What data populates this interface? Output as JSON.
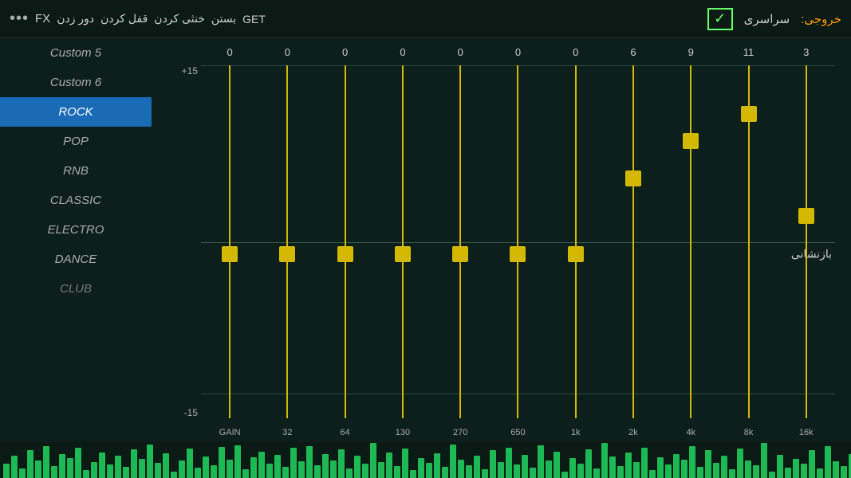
{
  "topbar": {
    "dots": "•••",
    "fx": "FX",
    "nav_items": [
      "دور زدن",
      "قفل کردن",
      "خنثی کردن",
      "بستن",
      "GET"
    ],
    "breadcrumb_label": "سراسری",
    "exit_label": "خروجی:",
    "check": "✓"
  },
  "sidebar": {
    "items": [
      {
        "label": "Custom 5",
        "active": false
      },
      {
        "label": "Custom 6",
        "active": false
      },
      {
        "label": "ROCK",
        "active": true
      },
      {
        "label": "POP",
        "active": false
      },
      {
        "label": "RNB",
        "active": false
      },
      {
        "label": "CLASSIC",
        "active": false
      },
      {
        "label": "ELECTRO",
        "active": false
      },
      {
        "label": "DANCE",
        "active": false
      },
      {
        "label": "CLUB",
        "active": false
      }
    ]
  },
  "eq": {
    "replay_label": "بازنشانی",
    "y_labels": [
      "+15",
      "",
      "",
      "",
      "",
      "",
      "-15"
    ],
    "columns": [
      {
        "label": "GAIN",
        "value": 0,
        "percent": 50
      },
      {
        "label": "32",
        "value": 0,
        "percent": 50
      },
      {
        "label": "64",
        "value": 0,
        "percent": 50
      },
      {
        "label": "130",
        "value": 0,
        "percent": 50
      },
      {
        "label": "270",
        "value": 0,
        "percent": 50
      },
      {
        "label": "650",
        "value": 0,
        "percent": 50
      },
      {
        "label": "1k",
        "value": 0,
        "percent": 50
      },
      {
        "label": "2k",
        "value": 6,
        "percent": 30
      },
      {
        "label": "4k",
        "value": 9,
        "percent": 22
      },
      {
        "label": "8k",
        "value": 11,
        "percent": 16
      },
      {
        "label": "16k",
        "value": 3,
        "percent": 42
      }
    ]
  },
  "spectrum": {
    "bars": [
      18,
      28,
      12,
      35,
      22,
      40,
      15,
      30,
      25,
      38,
      10,
      20,
      32,
      17,
      28,
      14,
      36,
      24,
      42,
      19,
      31,
      8,
      22,
      37,
      13,
      27,
      16,
      39,
      23,
      41,
      11,
      26,
      33,
      18,
      29,
      14,
      38,
      21,
      40,
      16,
      30,
      22,
      36,
      12,
      28,
      18,
      44,
      20,
      32,
      15,
      37,
      10,
      25,
      19,
      31,
      14,
      42,
      23,
      16,
      28,
      11,
      35,
      20,
      38,
      17,
      29,
      13,
      41,
      22,
      33,
      8,
      25,
      18,
      36,
      12,
      44,
      27,
      15,
      32,
      20,
      38,
      10,
      26,
      17,
      30,
      23,
      40,
      14,
      35,
      19,
      28,
      11,
      37,
      22,
      16,
      44,
      8,
      29,
      13,
      24,
      18,
      35,
      12,
      40,
      21,
      15,
      30,
      22,
      38,
      10
    ]
  }
}
